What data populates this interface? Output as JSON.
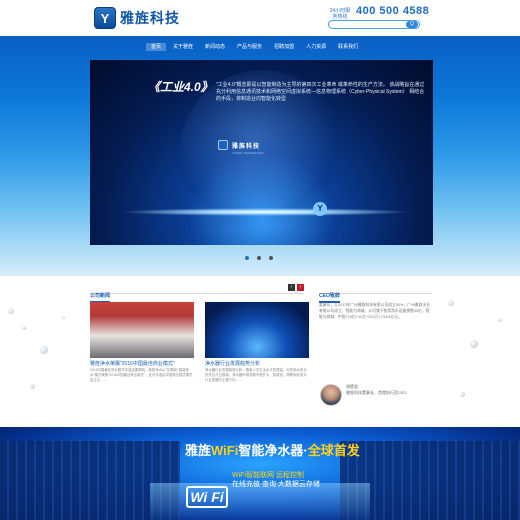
{
  "header": {
    "logo_mark": "Y",
    "logo_text": "雅旌科技",
    "hotline_label": "24小时服务热线",
    "hotline_number": "400 500 4588",
    "search_placeholder": "",
    "search_button": "Q"
  },
  "nav": {
    "items": [
      "首页",
      "关于雅旌",
      "新闻动态",
      "产品与服务",
      "招聘加盟",
      "人力资源",
      "联系我们"
    ],
    "active_index": 0
  },
  "banner": {
    "title": "《工业4.0》",
    "description": "\"工业4.0\"概念即是以智能制造为主导的第四次工业革命 或革命性的生产方法。 该战略旨在通过充分利用信息通讯技术和网络空间虚拟系统—信息物理系统（Cyber-Physical System） 相结合的手段，将制造业向智能化转型",
    "brand_name": "雅旌科技",
    "brand_sub": "YAJING TECHNOLOGY",
    "slide_count": 3,
    "active_slide": 0
  },
  "news": {
    "title": "公司新闻",
    "prev": "‹",
    "next": "›",
    "cards": [
      {
        "title": "雅旌净水荣膺\"2016中国最佳商业模式\"",
        "text": "2016中国最佳商业模式评选结果揭晓，雅旌净水以\"互联网+智能净水\"模式荣膺\"2016中国最佳商业模式\"，此次评选由中国商业模式委员会主办……"
      },
      {
        "title": "净水器行业发展趋势分析",
        "text": "净水器行业发展趋势分析：随着人们生活水平的提高，对饮用水安全的关注与日俱增，净水器市场规模不断扩大，智能化、物联网化成为行业发展的主要方向……"
      }
    ]
  },
  "ceo": {
    "title": "CEO致辞",
    "text": "董事长，至2013年广州雅旌科技有限公司成立50%，广州雅旌水业有限公司成立，智能与商城、公司旗下各类净水设备销售30亿，智能与商城：中国+15亿+12亿+200万=+34.6亿元。",
    "name": "胡楚君",
    "position": "雅旌科技董事长、首席执行官CEO"
  },
  "bottom": {
    "title_prefix": "雅旌",
    "title_highlight": "WiFi",
    "title_middle": "智能净水器·",
    "title_suffix": "全球首发",
    "badge": "Wi Fi",
    "line1": "WiFi智能联网  远程控制",
    "line2": "在线充值  查询  大数据云存储"
  },
  "colors": {
    "brand_blue": "#0d56a6",
    "accent_yellow": "#ffd21c",
    "accent_red": "#c21b2b"
  }
}
